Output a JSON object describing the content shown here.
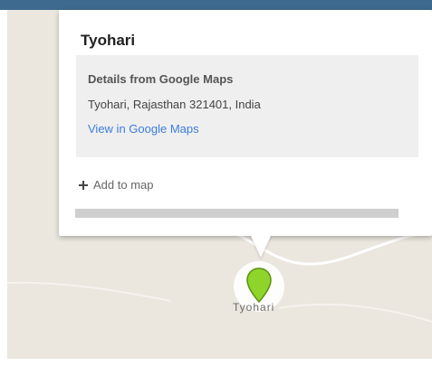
{
  "popup": {
    "title": "Tyohari",
    "details_heading": "Details from Google Maps",
    "address": "Tyohari, Rajasthan 321401, India",
    "view_link": "View in Google Maps",
    "add_to_map": "Add to map"
  },
  "map": {
    "place_label": "Tyohari",
    "marker_color": "#8fd42a",
    "background_color": "#ebe7df",
    "road_color": "#ffffff"
  },
  "colors": {
    "top_bar": "#3e6a8f",
    "link": "#3b7ddd"
  },
  "icons": {
    "add": "plus-icon",
    "marker": "map-pin-icon"
  }
}
